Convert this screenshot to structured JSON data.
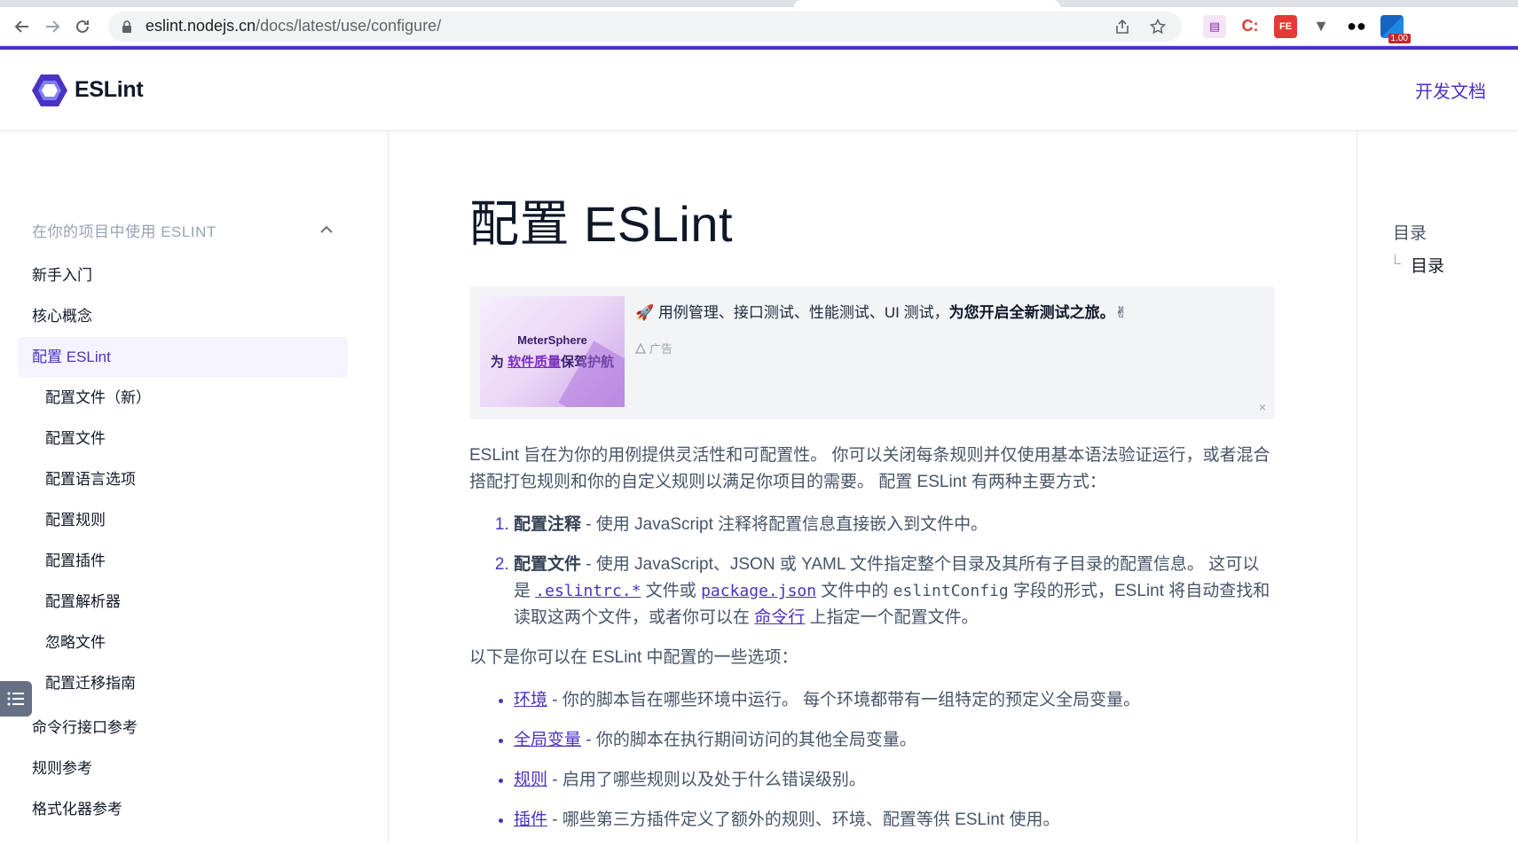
{
  "browser": {
    "url_host": "eslint.nodejs.cn",
    "url_path": "/docs/latest/use/configure/",
    "extension_badge": "1.00"
  },
  "header": {
    "logo_text": "ESLint",
    "nav_link": "开发文档"
  },
  "sidebar": {
    "section_title": "在你的项目中使用 ESLINT",
    "items": [
      {
        "label": "新手入门"
      },
      {
        "label": "核心概念"
      },
      {
        "label": "配置 ESLint"
      },
      {
        "label": "配置文件（新）"
      },
      {
        "label": "配置文件"
      },
      {
        "label": "配置语言选项"
      },
      {
        "label": "配置规则"
      },
      {
        "label": "配置插件"
      },
      {
        "label": "配置解析器"
      },
      {
        "label": "忽略文件"
      },
      {
        "label": "配置迁移指南"
      },
      {
        "label": "命令行接口参考"
      },
      {
        "label": "规则参考"
      },
      {
        "label": "格式化器参考"
      }
    ]
  },
  "main": {
    "title": "配置 ESLint",
    "ad": {
      "brand": "MeterSphere",
      "slogan_prefix": "为 ",
      "slogan_highlight": "软件质量",
      "slogan_suffix": "保驾护航",
      "line_prefix": "🚀 用例管理、接口测试、性能测试、UI 测试，",
      "line_bold": "为您开启全新测试之旅。",
      "line_emoji": "✌",
      "label": "广告",
      "close": "×"
    },
    "intro": "ESLint 旨在为你的用例提供灵活性和可配置性。 你可以关闭每条规则并仅使用基本语法验证运行，或者混合搭配打包规则和你的自定义规则以满足你项目的需要。 配置 ESLint 有两种主要方式：",
    "ordered": [
      {
        "strong": "配置注释",
        "text": " - 使用 JavaScript 注释将配置信息直接嵌入到文件中。"
      },
      {
        "strong": "配置文件",
        "text_a": " - 使用 JavaScript、JSON 或 YAML 文件指定整个目录及其所有子目录的配置信息。 这可以是 ",
        "code_a": ".eslintrc.*",
        "text_b": " 文件或 ",
        "code_b": "package.json",
        "text_c": " 文件中的 ",
        "code_c": "eslintConfig",
        "text_d": " 字段的形式，ESLint 将自动查找和读取这两个文件，或者你可以在 ",
        "link": "命令行",
        "text_e": " 上指定一个配置文件。"
      }
    ],
    "options_intro": "以下是你可以在 ESLint 中配置的一些选项：",
    "options": [
      {
        "link": "环境",
        "text": " - 你的脚本旨在哪些环境中运行。 每个环境都带有一组特定的预定义全局变量。"
      },
      {
        "link": "全局变量",
        "text": " - 你的脚本在执行期间访问的其他全局变量。"
      },
      {
        "link": "规则",
        "text": " - 启用了哪些规则以及处于什么错误级别。"
      },
      {
        "link": "插件",
        "text": " - 哪些第三方插件定义了额外的规则、环境、配置等供 ESLint 使用。"
      }
    ]
  },
  "toc": {
    "title": "目录",
    "items": [
      {
        "label": "目录"
      }
    ]
  }
}
